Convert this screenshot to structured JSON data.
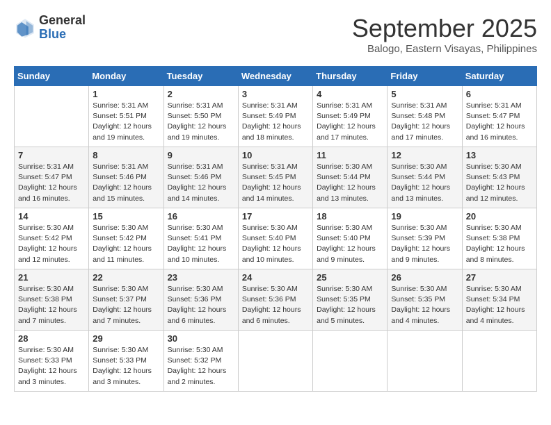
{
  "header": {
    "logo_general": "General",
    "logo_blue": "Blue",
    "month": "September 2025",
    "location": "Balogo, Eastern Visayas, Philippines"
  },
  "days_of_week": [
    "Sunday",
    "Monday",
    "Tuesday",
    "Wednesday",
    "Thursday",
    "Friday",
    "Saturday"
  ],
  "weeks": [
    [
      {
        "day": "",
        "info": ""
      },
      {
        "day": "1",
        "info": "Sunrise: 5:31 AM\nSunset: 5:51 PM\nDaylight: 12 hours\nand 19 minutes."
      },
      {
        "day": "2",
        "info": "Sunrise: 5:31 AM\nSunset: 5:50 PM\nDaylight: 12 hours\nand 19 minutes."
      },
      {
        "day": "3",
        "info": "Sunrise: 5:31 AM\nSunset: 5:49 PM\nDaylight: 12 hours\nand 18 minutes."
      },
      {
        "day": "4",
        "info": "Sunrise: 5:31 AM\nSunset: 5:49 PM\nDaylight: 12 hours\nand 17 minutes."
      },
      {
        "day": "5",
        "info": "Sunrise: 5:31 AM\nSunset: 5:48 PM\nDaylight: 12 hours\nand 17 minutes."
      },
      {
        "day": "6",
        "info": "Sunrise: 5:31 AM\nSunset: 5:47 PM\nDaylight: 12 hours\nand 16 minutes."
      }
    ],
    [
      {
        "day": "7",
        "info": "Sunrise: 5:31 AM\nSunset: 5:47 PM\nDaylight: 12 hours\nand 16 minutes."
      },
      {
        "day": "8",
        "info": "Sunrise: 5:31 AM\nSunset: 5:46 PM\nDaylight: 12 hours\nand 15 minutes."
      },
      {
        "day": "9",
        "info": "Sunrise: 5:31 AM\nSunset: 5:46 PM\nDaylight: 12 hours\nand 14 minutes."
      },
      {
        "day": "10",
        "info": "Sunrise: 5:31 AM\nSunset: 5:45 PM\nDaylight: 12 hours\nand 14 minutes."
      },
      {
        "day": "11",
        "info": "Sunrise: 5:30 AM\nSunset: 5:44 PM\nDaylight: 12 hours\nand 13 minutes."
      },
      {
        "day": "12",
        "info": "Sunrise: 5:30 AM\nSunset: 5:44 PM\nDaylight: 12 hours\nand 13 minutes."
      },
      {
        "day": "13",
        "info": "Sunrise: 5:30 AM\nSunset: 5:43 PM\nDaylight: 12 hours\nand 12 minutes."
      }
    ],
    [
      {
        "day": "14",
        "info": "Sunrise: 5:30 AM\nSunset: 5:42 PM\nDaylight: 12 hours\nand 12 minutes."
      },
      {
        "day": "15",
        "info": "Sunrise: 5:30 AM\nSunset: 5:42 PM\nDaylight: 12 hours\nand 11 minutes."
      },
      {
        "day": "16",
        "info": "Sunrise: 5:30 AM\nSunset: 5:41 PM\nDaylight: 12 hours\nand 10 minutes."
      },
      {
        "day": "17",
        "info": "Sunrise: 5:30 AM\nSunset: 5:40 PM\nDaylight: 12 hours\nand 10 minutes."
      },
      {
        "day": "18",
        "info": "Sunrise: 5:30 AM\nSunset: 5:40 PM\nDaylight: 12 hours\nand 9 minutes."
      },
      {
        "day": "19",
        "info": "Sunrise: 5:30 AM\nSunset: 5:39 PM\nDaylight: 12 hours\nand 9 minutes."
      },
      {
        "day": "20",
        "info": "Sunrise: 5:30 AM\nSunset: 5:38 PM\nDaylight: 12 hours\nand 8 minutes."
      }
    ],
    [
      {
        "day": "21",
        "info": "Sunrise: 5:30 AM\nSunset: 5:38 PM\nDaylight: 12 hours\nand 7 minutes."
      },
      {
        "day": "22",
        "info": "Sunrise: 5:30 AM\nSunset: 5:37 PM\nDaylight: 12 hours\nand 7 minutes."
      },
      {
        "day": "23",
        "info": "Sunrise: 5:30 AM\nSunset: 5:36 PM\nDaylight: 12 hours\nand 6 minutes."
      },
      {
        "day": "24",
        "info": "Sunrise: 5:30 AM\nSunset: 5:36 PM\nDaylight: 12 hours\nand 6 minutes."
      },
      {
        "day": "25",
        "info": "Sunrise: 5:30 AM\nSunset: 5:35 PM\nDaylight: 12 hours\nand 5 minutes."
      },
      {
        "day": "26",
        "info": "Sunrise: 5:30 AM\nSunset: 5:35 PM\nDaylight: 12 hours\nand 4 minutes."
      },
      {
        "day": "27",
        "info": "Sunrise: 5:30 AM\nSunset: 5:34 PM\nDaylight: 12 hours\nand 4 minutes."
      }
    ],
    [
      {
        "day": "28",
        "info": "Sunrise: 5:30 AM\nSunset: 5:33 PM\nDaylight: 12 hours\nand 3 minutes."
      },
      {
        "day": "29",
        "info": "Sunrise: 5:30 AM\nSunset: 5:33 PM\nDaylight: 12 hours\nand 3 minutes."
      },
      {
        "day": "30",
        "info": "Sunrise: 5:30 AM\nSunset: 5:32 PM\nDaylight: 12 hours\nand 2 minutes."
      },
      {
        "day": "",
        "info": ""
      },
      {
        "day": "",
        "info": ""
      },
      {
        "day": "",
        "info": ""
      },
      {
        "day": "",
        "info": ""
      }
    ]
  ]
}
